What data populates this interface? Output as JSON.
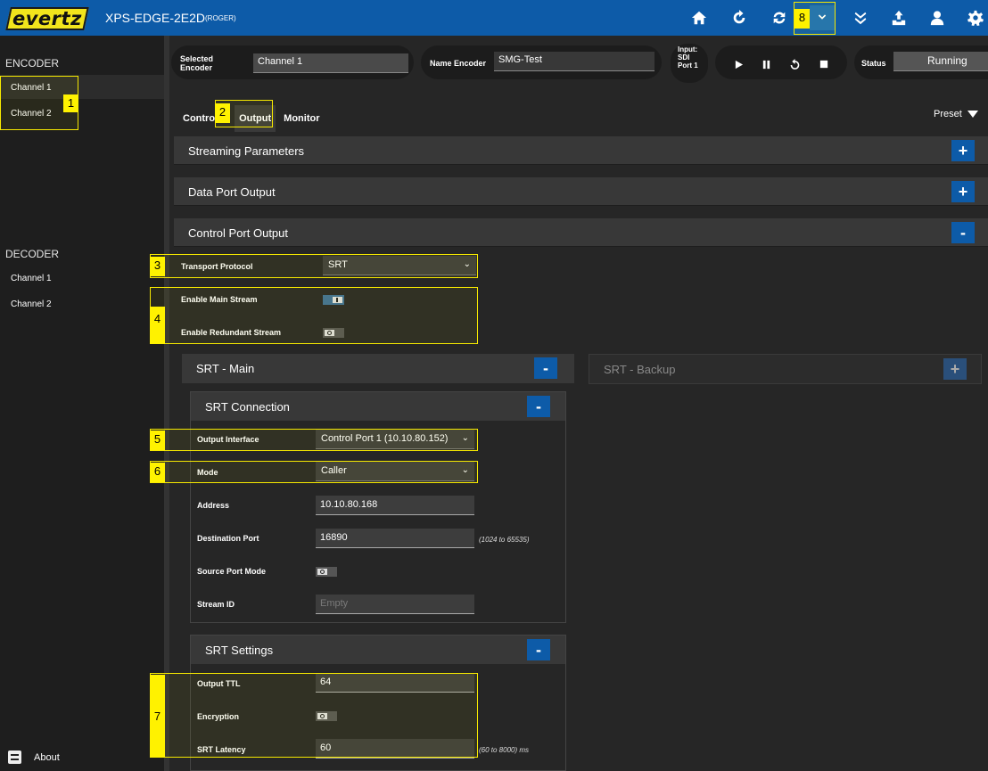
{
  "header": {
    "logo_text": "evertz",
    "device_name": "XPS-EDGE-2E2D",
    "device_user": "(ROGER)",
    "icons": [
      "home-icon",
      "refresh-icon",
      "sync-icon",
      "chevron-down-icon",
      "double-chevron-down-icon",
      "upload-icon",
      "user-icon",
      "gear-icon"
    ]
  },
  "sidebar": {
    "encoder_label": "ENCODER",
    "encoder_channels": [
      "Channel 1",
      "Channel 2"
    ],
    "decoder_label": "DECODER",
    "decoder_channels": [
      "Channel 1",
      "Channel 2"
    ],
    "about_label": "About"
  },
  "infobar": {
    "selected_encoder_label": "Selected Encoder",
    "selected_encoder_value": "Channel 1",
    "name_encoder_label": "Name Encoder",
    "name_encoder_value": "SMG-Test",
    "input_label": "Input: SDI Port 1",
    "status_label": "Status",
    "status_value": "Running"
  },
  "tabs": [
    "Control",
    "Output",
    "Monitor"
  ],
  "preset_label": "Preset",
  "sections": {
    "streaming": "Streaming Parameters",
    "data_port": "Data Port Output",
    "control_port": "Control Port Output"
  },
  "control_port": {
    "transport_protocol_label": "Transport Protocol",
    "transport_protocol_value": "SRT",
    "enable_main_label": "Enable Main Stream",
    "enable_redundant_label": "Enable Redundant Stream"
  },
  "srt_main": {
    "title": "SRT - Main",
    "connection_title": "SRT Connection",
    "output_interface_label": "Output Interface",
    "output_interface_value": "Control Port 1 (10.10.80.152)",
    "mode_label": "Mode",
    "mode_value": "Caller",
    "address_label": "Address",
    "address_value": "10.10.80.168",
    "dest_port_label": "Destination Port",
    "dest_port_value": "16890",
    "dest_port_hint": "(1024 to 65535)",
    "source_port_mode_label": "Source Port Mode",
    "stream_id_label": "Stream ID",
    "stream_id_placeholder": "Empty",
    "settings_title": "SRT Settings",
    "ttl_label": "Output TTL",
    "ttl_value": "64",
    "encryption_label": "Encryption",
    "latency_label": "SRT Latency",
    "latency_value": "60",
    "latency_hint": "(60 to 8000) ms"
  },
  "srt_backup": {
    "title": "SRT - Backup"
  },
  "annotations": [
    "1",
    "2",
    "3",
    "4",
    "5",
    "6",
    "7",
    "8"
  ]
}
